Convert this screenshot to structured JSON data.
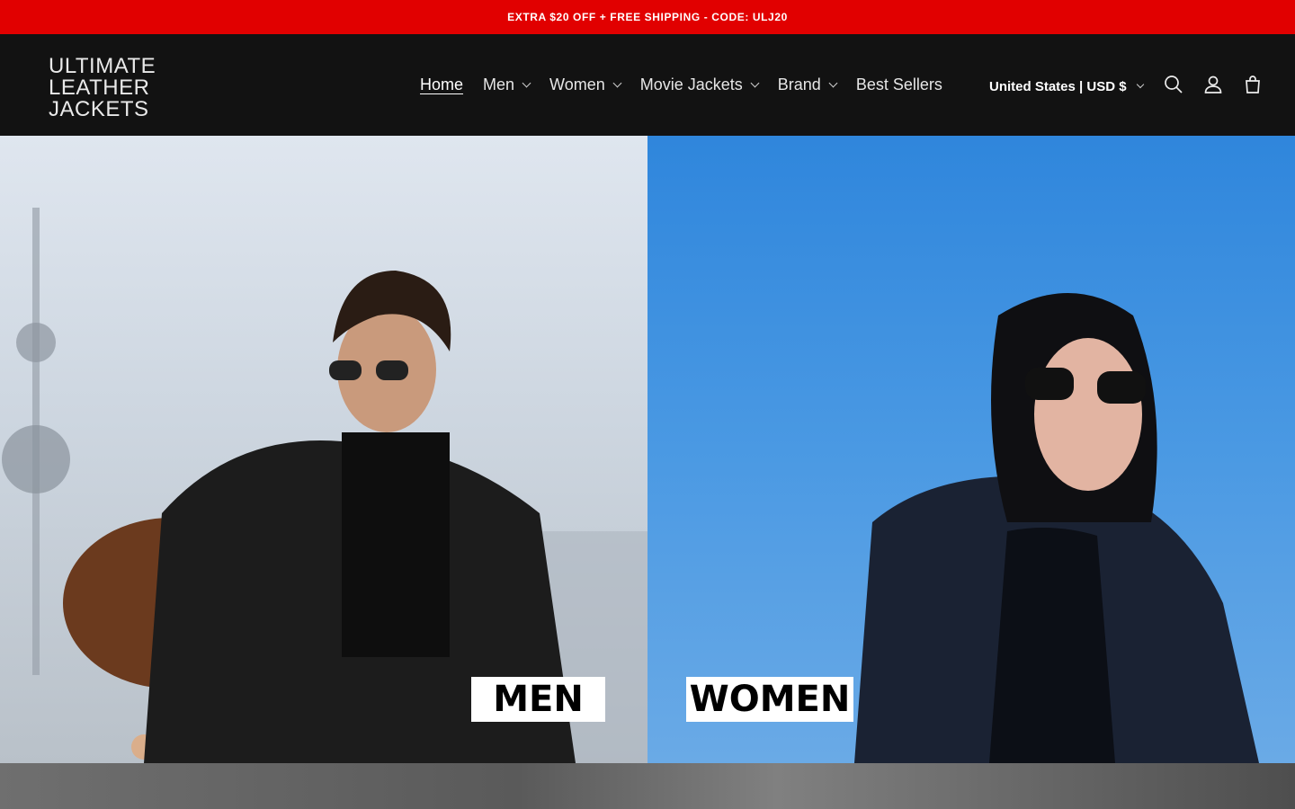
{
  "announcement": {
    "text": "EXTRA $20 OFF + FREE SHIPPING - CODE: ULJ20"
  },
  "header": {
    "logo_lines": [
      "ULTIMATE",
      "LEATHER",
      "JACKETS"
    ],
    "nav": [
      {
        "label": "Home",
        "active": true,
        "dropdown": false
      },
      {
        "label": "Men",
        "active": false,
        "dropdown": true
      },
      {
        "label": "Women",
        "active": false,
        "dropdown": true
      },
      {
        "label": "Movie Jackets",
        "active": false,
        "dropdown": true
      },
      {
        "label": "Brand",
        "active": false,
        "dropdown": true
      },
      {
        "label": "Best Sellers",
        "active": false,
        "dropdown": false
      }
    ],
    "region": "United States | USD $",
    "icons": [
      "search-icon",
      "account-icon",
      "cart-icon"
    ]
  },
  "hero": {
    "men_label": "MEN",
    "women_label": "WOMEN"
  },
  "colors": {
    "announcement_bg": "#e10000",
    "header_bg": "#121212"
  }
}
